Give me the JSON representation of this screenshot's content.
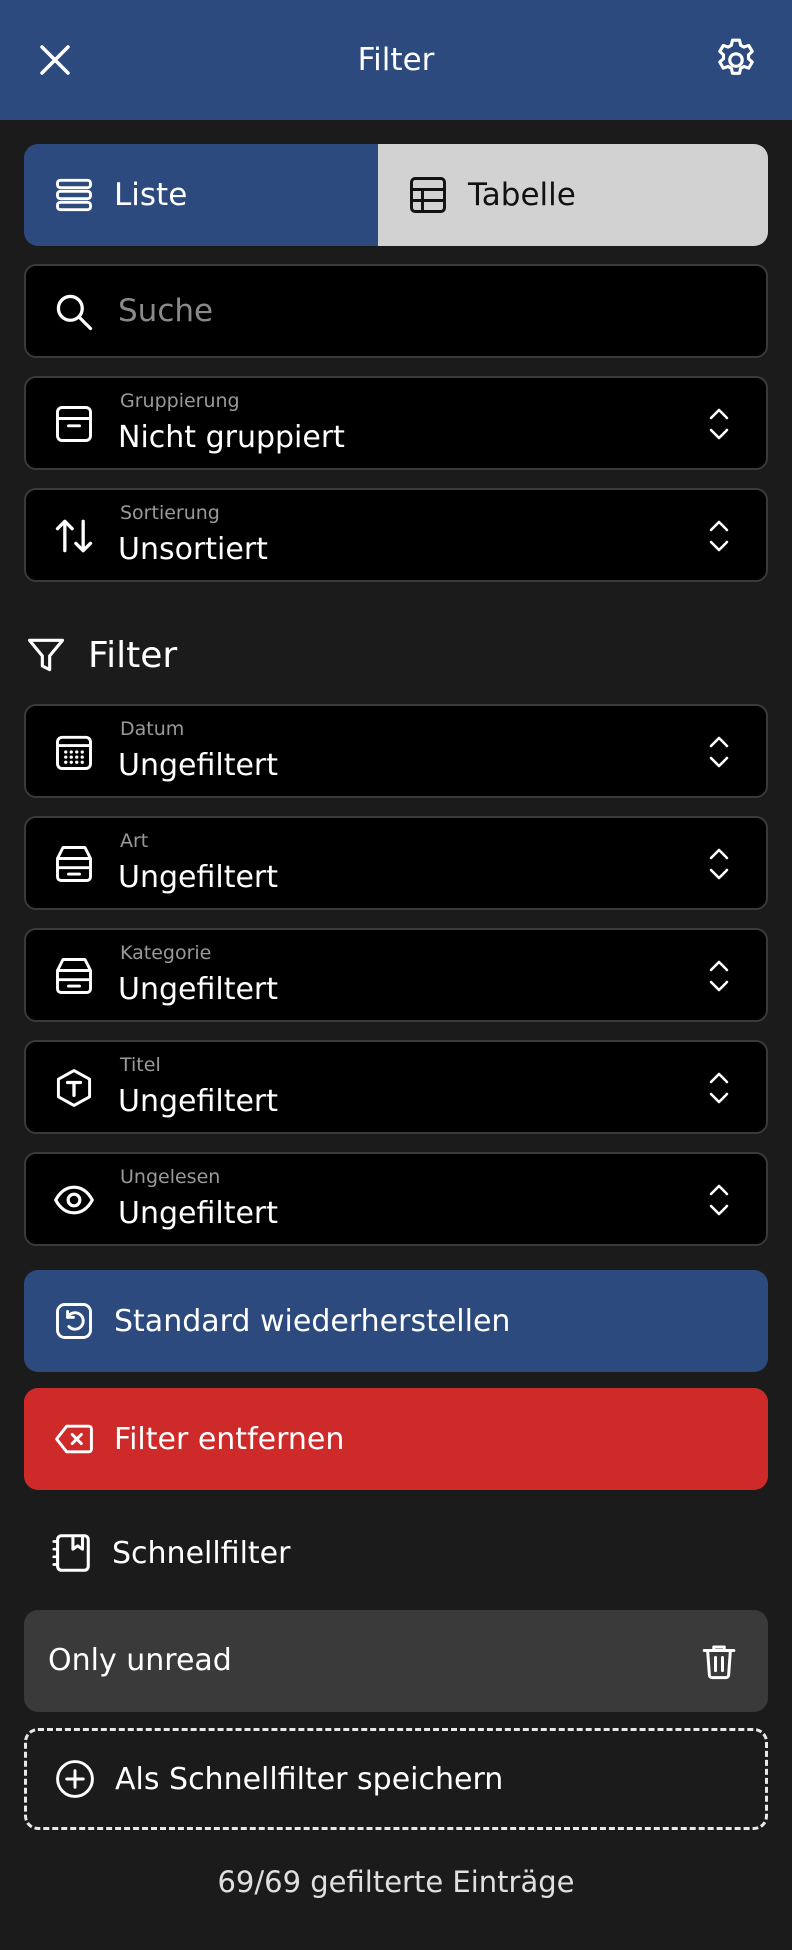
{
  "header": {
    "title": "Filter",
    "close_icon": "close-icon",
    "settings_icon": "gear-icon"
  },
  "view_toggle": {
    "options": [
      {
        "label": "Liste",
        "icon": "list-icon",
        "selected": true
      },
      {
        "label": "Tabelle",
        "icon": "table-icon",
        "selected": false
      }
    ]
  },
  "search": {
    "placeholder": "Suche",
    "value": ""
  },
  "grouping": {
    "label": "Gruppierung",
    "value": "Nicht gruppiert"
  },
  "sorting": {
    "label": "Sortierung",
    "value": "Unsortiert"
  },
  "filter_section": {
    "title": "Filter",
    "fields": [
      {
        "label": "Datum",
        "value": "Ungefiltert",
        "icon": "calendar-icon"
      },
      {
        "label": "Art",
        "value": "Ungefiltert",
        "icon": "tray-icon"
      },
      {
        "label": "Kategorie",
        "value": "Ungefiltert",
        "icon": "tray-icon"
      },
      {
        "label": "Titel",
        "value": "Ungefiltert",
        "icon": "title-tag-icon"
      },
      {
        "label": "Ungelesen",
        "value": "Ungefiltert",
        "icon": "eye-icon"
      }
    ]
  },
  "actions": {
    "restore_label": "Standard wiederherstellen",
    "remove_label": "Filter entfernen"
  },
  "quick_filters": {
    "title": "Schnellfilter",
    "items": [
      {
        "label": "Only unread"
      }
    ],
    "save_label": "Als Schnellfilter speichern"
  },
  "footer": {
    "count_text": "69/69 gefilterte Einträge"
  },
  "colors": {
    "header_bg": "#2c4a7e",
    "accent_blue": "#2c4a7e",
    "danger_red": "#cf2a2a",
    "background": "#1b1b1b",
    "field_bg": "#000000"
  }
}
